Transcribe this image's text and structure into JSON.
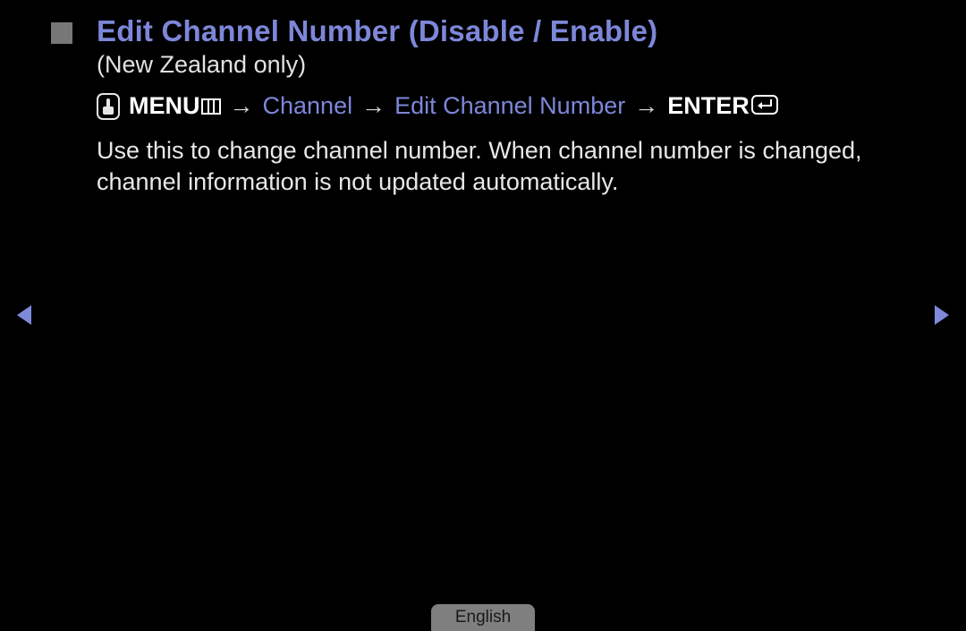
{
  "title": "Edit Channel Number (Disable / Enable)",
  "subtitle": "(New Zealand only)",
  "path": {
    "menu_label": "MENU",
    "channel_label": "Channel",
    "edit_label": "Edit Channel Number",
    "enter_label": "ENTER",
    "arrow": "→"
  },
  "body": "Use this to change channel number. When channel number is changed, channel information is not updated automatically.",
  "language": "English"
}
